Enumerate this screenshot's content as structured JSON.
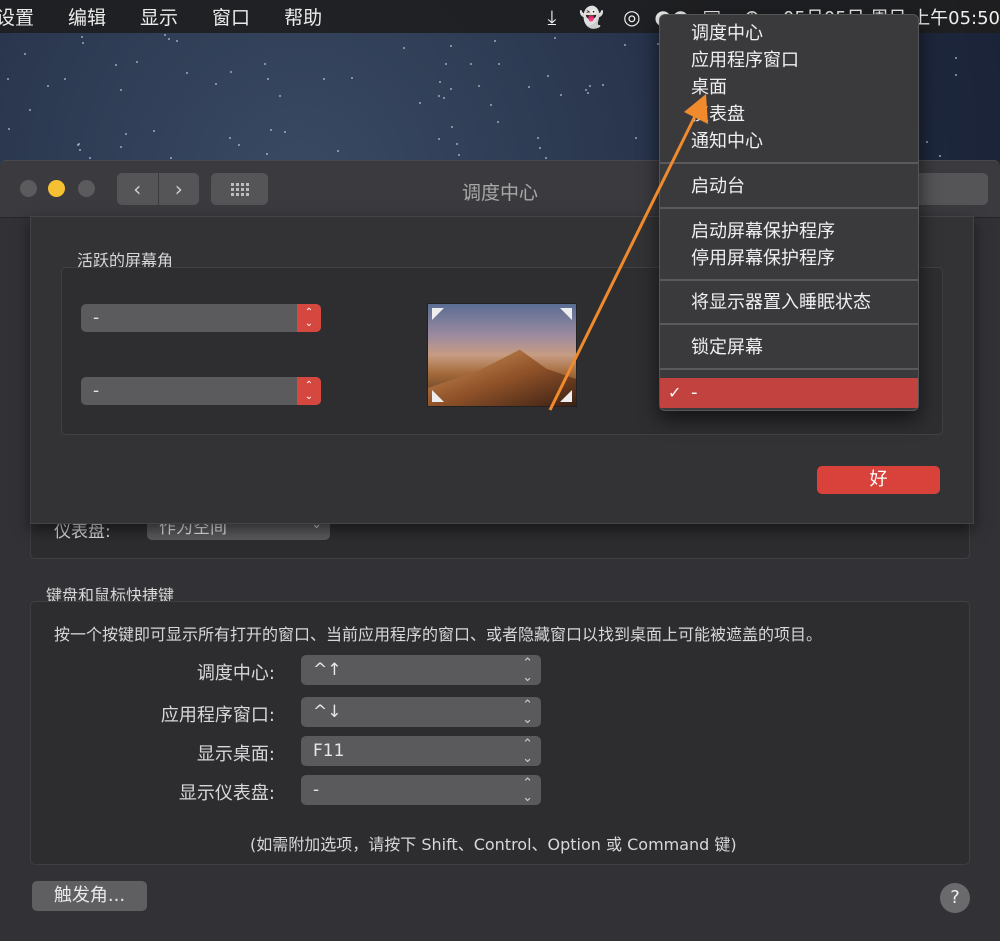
{
  "menubar": {
    "items": [
      "设置",
      "编辑",
      "显示",
      "窗口",
      "帮助"
    ],
    "clock": "05月05日 周日 上午05:50"
  },
  "window": {
    "title": "调度中心",
    "nav_back": "‹",
    "nav_forward": "›"
  },
  "background": {
    "dashboard_label": "仪表盘:",
    "dashboard_value": "作为空间",
    "shortcuts_title": "键盘和鼠标快捷键",
    "shortcuts_desc": "按一个按键即可显示所有打开的窗口、当前应用程序的窗口、或者隐藏窗口以找到桌面上可能被遮盖的项目。",
    "rows": [
      {
        "label": "调度中心:",
        "value": "^↑"
      },
      {
        "label": "应用程序窗口:",
        "value": "^↓"
      },
      {
        "label": "显示桌面:",
        "value": "F11"
      },
      {
        "label": "显示仪表盘:",
        "value": "-"
      }
    ],
    "hint": "(如需附加选项，请按下 Shift、Control、Option 或 Command 键)",
    "hot_corners_button": "触发角...",
    "help": "?"
  },
  "sheet": {
    "group_title": "活跃的屏幕角",
    "top_left_value": "-",
    "bottom_left_value": "-",
    "ok_label": "好"
  },
  "menu": {
    "groups": [
      [
        "调度中心",
        "应用程序窗口",
        "桌面",
        "仪表盘",
        "通知中心"
      ],
      [
        "启动台"
      ],
      [
        "启动屏幕保护程序",
        "停用屏幕保护程序"
      ],
      [
        "将显示器置入睡眠状态"
      ],
      [
        "锁定屏幕"
      ]
    ],
    "selected_item": "-",
    "check": "✓"
  },
  "colors": {
    "accent_red": "#d9413b",
    "annotation_arrow": "#f08a2c"
  },
  "icons": [
    "download-icon",
    "ghost-icon",
    "network-icon",
    "dots-icon",
    "display-icon",
    "globe-icon"
  ]
}
